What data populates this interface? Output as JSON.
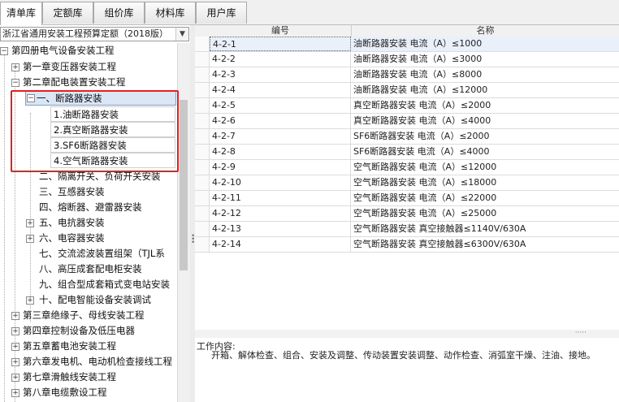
{
  "tabs": [
    "清单库",
    "定额库",
    "组价库",
    "材料库",
    "用户库"
  ],
  "quota_select": {
    "value": "浙江省通用安装工程预算定额（2018版）"
  },
  "tree": {
    "root": "第四册电气设备安装工程",
    "ch1": "第一章变压器安装工程",
    "ch2": "第二章配电装置安装工程",
    "sec1": "一、断路器安装",
    "sub1": "1.油断路器安装",
    "sub2": "2.真空断路器安装",
    "sub3": "3.SF6断路器安装",
    "sub4": "4.空气断路器安装",
    "sec2": "二、隔离开关、负荷开关安装",
    "sec3": "三、互感器安装",
    "sec4": "四、熔断器、避雷器安装",
    "sec5": "五、电抗器安装",
    "sec6": "六、电容器安装",
    "sec7": "七、交流滤波装置组架（TJL系",
    "sec8": "八、高压成套配电柜安装",
    "sec9": "九、组合型成套箱式变电站安装",
    "sec10": "十、配电智能设备安装调试",
    "ch3": "第三章绝缘子、母线安装工程",
    "ch4": "第四章控制设备及低压电器",
    "ch5": "第五章蓄电池安装工程",
    "ch6": "第六章发电机、电动机检查接线工程",
    "ch7": "第七章滑触线安装工程",
    "ch8": "第八章电缆敷设工程"
  },
  "table": {
    "headers": [
      "编号",
      "名称"
    ],
    "rows": [
      {
        "code": "4-2-1",
        "name": "油断路器安装 电流（A）≤1000"
      },
      {
        "code": "4-2-2",
        "name": "油断路器安装 电流（A）≤3000"
      },
      {
        "code": "4-2-3",
        "name": "油断路器安装 电流（A）≤8000"
      },
      {
        "code": "4-2-4",
        "name": "油断路器安装 电流（A）≤12000"
      },
      {
        "code": "4-2-5",
        "name": "真空断路器安装 电流（A）≤2000"
      },
      {
        "code": "4-2-6",
        "name": "真空断路器安装 电流（A）≤4000"
      },
      {
        "code": "4-2-7",
        "name": "SF6断路器安装 电流（A）≤2000"
      },
      {
        "code": "4-2-8",
        "name": "SF6断路器安装 电流（A）≤4000"
      },
      {
        "code": "4-2-9",
        "name": "空气断路器安装 电流（A）≤12000"
      },
      {
        "code": "4-2-10",
        "name": "空气断路器安装 电流（A）≤18000"
      },
      {
        "code": "4-2-11",
        "name": "空气断路器安装 电流（A）≤22000"
      },
      {
        "code": "4-2-12",
        "name": "空气断路器安装 电流（A）≤25000"
      },
      {
        "code": "4-2-13",
        "name": "空气断路器安装 真空接触器≤1140V/630A"
      },
      {
        "code": "4-2-14",
        "name": "空气断路器安装 真空接触器≤6300V/630A"
      }
    ]
  },
  "work": {
    "title": "工作内容:",
    "content": "开箱、解体检查、组合、安装及调整、传动装置安装调整、动作检查、消弧室干燥、注油、接地。"
  },
  "colors": {
    "highlight_border": "#e32020",
    "selection": "#dbe6f4"
  }
}
